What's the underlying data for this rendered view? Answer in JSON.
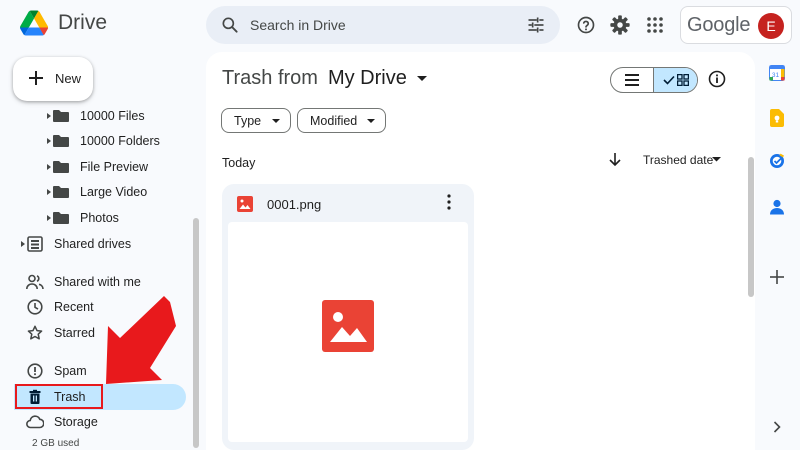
{
  "app": {
    "name": "Drive"
  },
  "search": {
    "placeholder": "Search in Drive"
  },
  "account": {
    "brand": "Google",
    "avatar_initial": "E"
  },
  "new_button": {
    "label": "New"
  },
  "sidebar": {
    "folders": [
      "10000 Files",
      "10000 Folders",
      "File Preview",
      "Large Video",
      "Photos"
    ],
    "shared_drives": "Shared drives",
    "shared_with_me": "Shared with me",
    "recent": "Recent",
    "starred": "Starred",
    "spam": "Spam",
    "trash": "Trash",
    "storage": "Storage",
    "storage_used": "2 GB used"
  },
  "main": {
    "title_prefix": "Trash from",
    "title_location": "My Drive",
    "filters": {
      "type": "Type",
      "modified": "Modified"
    },
    "section": "Today",
    "sort_label": "Trashed date",
    "view": "grid",
    "files": [
      {
        "name": "0001.png",
        "icon": "image-icon"
      }
    ]
  },
  "colors": {
    "accent": "#c2e7ff",
    "annotation": "#e8191c",
    "avatar": "#c5221f",
    "image_icon": "#ea4335"
  }
}
